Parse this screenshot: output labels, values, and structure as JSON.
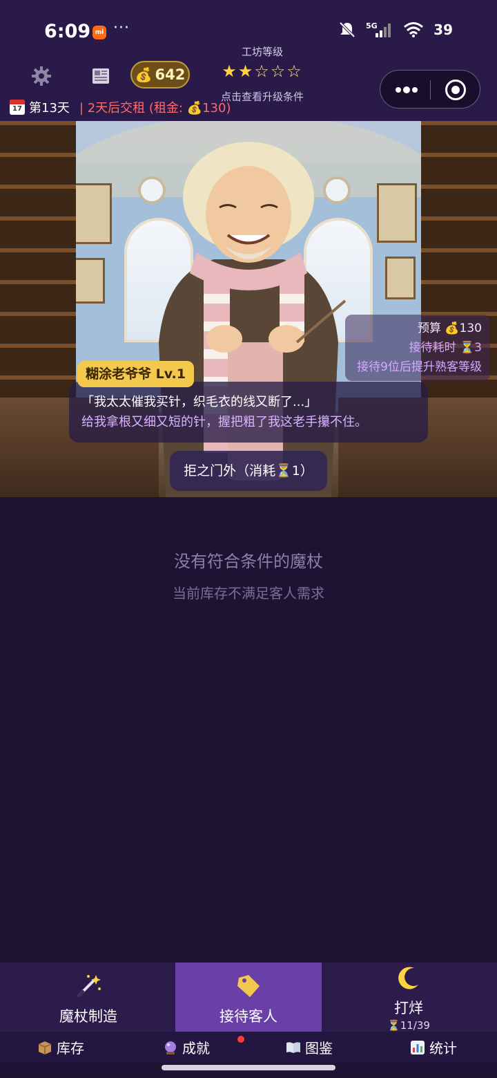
{
  "status_bar": {
    "time": "6:09",
    "mi_badge": "mi",
    "more_dots": "···",
    "network": "5G",
    "battery": "39"
  },
  "header": {
    "coins": "642",
    "level_label": "工坊等级",
    "stars_filled": "★★",
    "stars_empty": "☆☆☆",
    "level_hint": "点击查看升级条件",
    "day": "第13天",
    "rent_notice": "| 2天后交租 (租金: 💰130)",
    "calendar_day": "17"
  },
  "customer": {
    "name": "糊涂老爷爷 Lv.1",
    "budget": "预算 💰130",
    "service_time": "接待耗时 ⏳3",
    "promote_hint": "接待9位后提升熟客等级",
    "dialog_line1": "「我太太催我买针，织毛衣的线又断了...」",
    "dialog_line2": "给我拿根又细又短的针，握把粗了我这老手攥不住。",
    "reject_button": "拒之门外（消耗⏳1）"
  },
  "empty_state": {
    "title": "没有符合条件的魔杖",
    "subtitle": "当前库存不满足客人需求"
  },
  "main_tabs": [
    {
      "label": "魔杖制造",
      "icon": "magic-wand-icon"
    },
    {
      "label": "接待客人",
      "icon": "price-tag-icon",
      "selected": true
    },
    {
      "label": "打烊",
      "sub": "⏳11/39",
      "icon": "moon-icon"
    }
  ],
  "sub_tabs": [
    {
      "label": "库存",
      "icon": "box-icon"
    },
    {
      "label": "成就",
      "icon": "crystal-ball-icon",
      "badge": true
    },
    {
      "label": "图鉴",
      "icon": "book-icon"
    },
    {
      "label": "统计",
      "icon": "bar-chart-icon"
    }
  ],
  "colors": {
    "background": "#1e1333",
    "header": "#2a1a4a",
    "selected_tab": "#6a3fa8",
    "name_tag": "#f2c94c",
    "rent_red": "#ff6b6b",
    "accent_purple": "#d9b3ff"
  }
}
